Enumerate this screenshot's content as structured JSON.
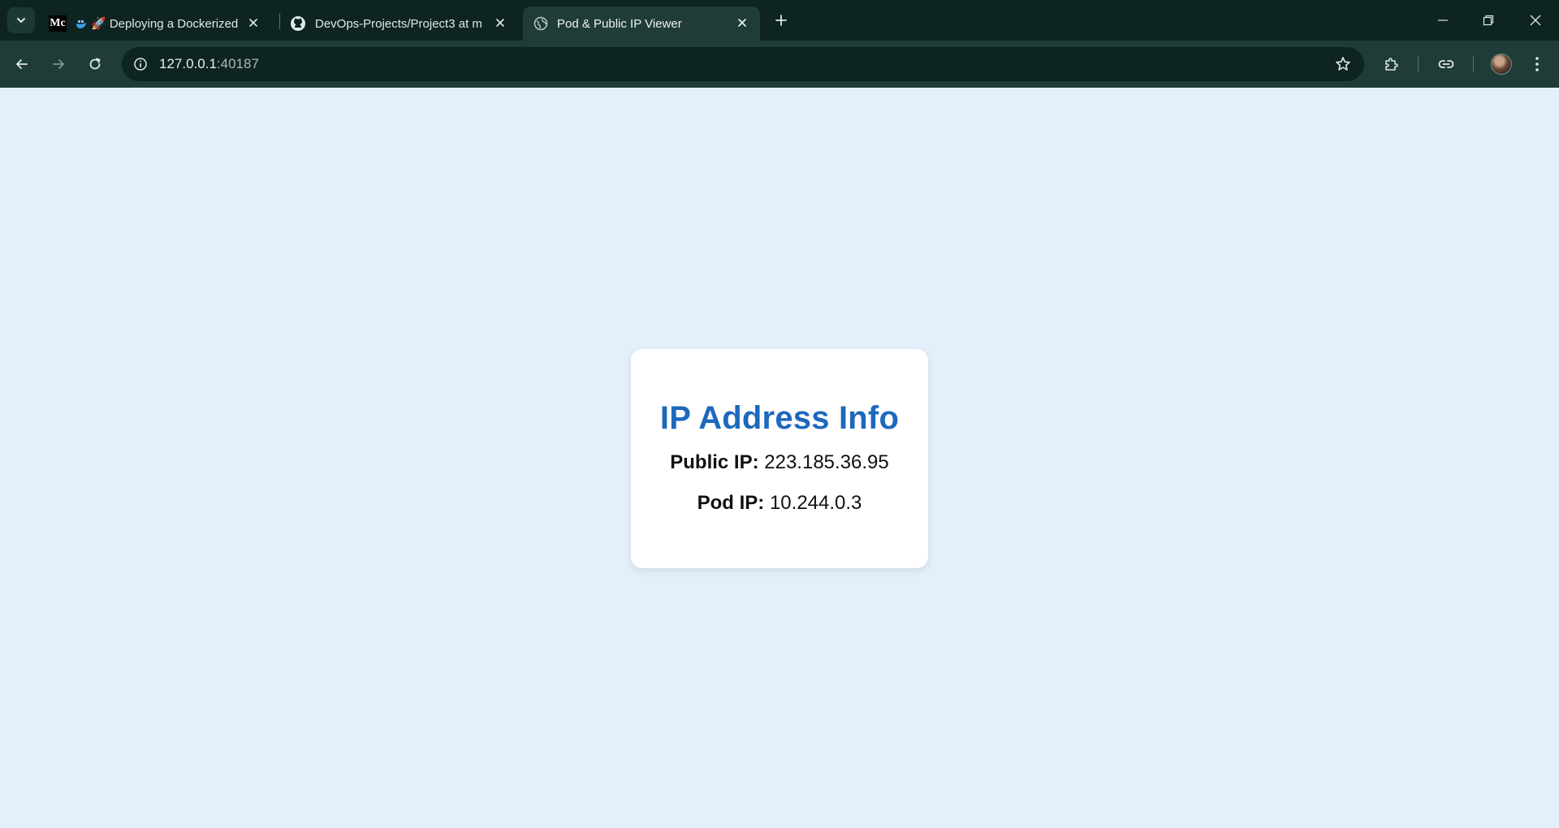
{
  "browser": {
    "tabs": [
      {
        "title": "🚀 Deploying a Dockerized",
        "favicon": "medium-favicon",
        "active": false
      },
      {
        "title": "DevOps-Projects/Project3 at m",
        "favicon": "github-favicon",
        "active": false
      },
      {
        "title": "Pod & Public IP Viewer",
        "favicon": "globe-favicon",
        "active": true
      }
    ],
    "tab0_prefix": "Mc",
    "url_host": "127.0.0.1",
    "url_port": ":40187",
    "colors": {
      "frame": "#0d2421",
      "toolbar": "#1f3c38",
      "page_bg": "#e3f0fc",
      "accent": "#1e68bd"
    }
  },
  "page": {
    "heading": "IP Address Info",
    "public_ip_label": "Public IP:",
    "public_ip_value": "223.185.36.95",
    "pod_ip_label": "Pod IP:",
    "pod_ip_value": "10.244.0.3"
  }
}
